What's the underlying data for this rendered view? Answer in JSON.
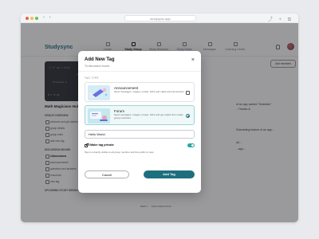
{
  "browser": {
    "url": "studysync.app"
  },
  "header": {
    "logo": "Studysync",
    "nav": [
      {
        "label": "Home",
        "icon": "home-icon",
        "active": false
      },
      {
        "label": "Study Group",
        "icon": "group-icon",
        "active": true
      },
      {
        "label": "Study Sessions",
        "icon": "calendar-icon",
        "active": false
      },
      {
        "label": "Study Notes",
        "icon": "notes-icon",
        "active": false
      },
      {
        "label": "Messages",
        "icon": "message-icon",
        "active": false
      },
      {
        "label": "Learning Center",
        "icon": "book-icon",
        "active": false
      }
    ]
  },
  "background": {
    "group_name": "Math Magicians Hub",
    "group_overview_label": "GROUP OVERVIEW",
    "overview_items": [
      "welcome and get started",
      "group details",
      "group rules",
      "add new tag"
    ],
    "discussion_label": "DISCUSSION BOARD",
    "discussion_items": [
      "#discussions",
      "announcements",
      "questions and answers",
      "resources",
      "new tag"
    ],
    "upcoming_label": "UPCOMING STUDY SESSIONS",
    "back_label": "Back",
    "channel": "#discussions",
    "add_members": "Add members",
    "post_snippets": [
      "of an app named \"Schedule\"",
      "...Thanks &",
      "Scheduling feature of an app...",
      "all...",
      "...app..."
    ],
    "reply_label": "REPLY",
    "reaction_label": "ADD A REACTION"
  },
  "modal": {
    "title": "Add New Tag",
    "subtitle": "To discussion board",
    "tag_type_label": "TAG TYPE",
    "options": [
      {
        "title": "Announcement",
        "description": "Send messages, images, emojis, GIFs and make announcements",
        "control": "checkbox",
        "selected": false
      },
      {
        "title": "Forum",
        "description": "Send messages, images, emojis, GIFs and get replies from study group members",
        "control": "radio",
        "selected": true
      }
    ],
    "tag_name_value": "Hello World",
    "private_label": "Make tag private",
    "private_enabled": true,
    "private_description": "Tag is currently visible to all group member and the public to view",
    "cancel_label": "Cancel",
    "add_label": "Add Tag"
  },
  "colors": {
    "primary": "#1e6f7e",
    "toggle": "#28a9a4",
    "selected_card_bg": "#eef8f8"
  }
}
